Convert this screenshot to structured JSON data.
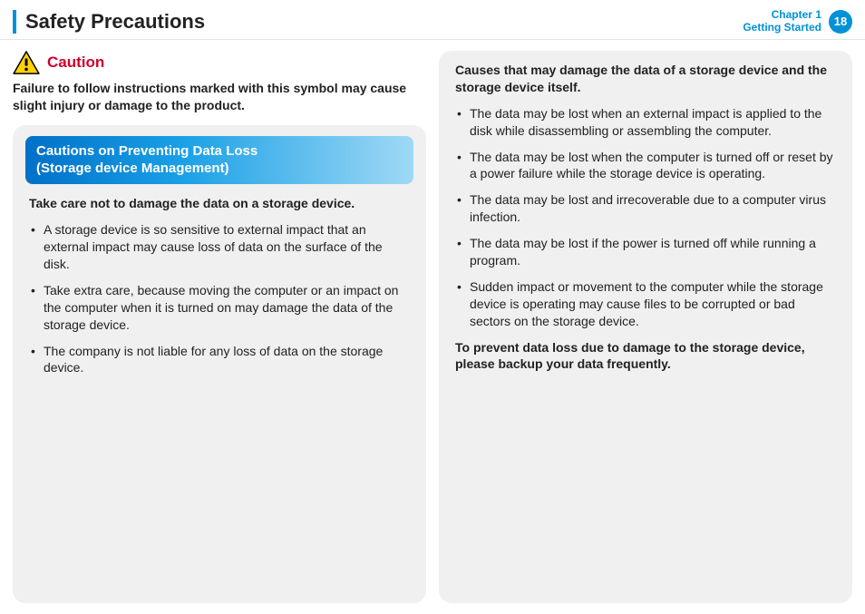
{
  "header": {
    "title": "Safety Precautions",
    "chapter_line1": "Chapter 1",
    "chapter_line2": "Getting Started",
    "page_number": "18"
  },
  "left": {
    "caution_label": "Caution",
    "caution_text": "Failure to follow instructions marked with this symbol may cause slight injury or damage to the product.",
    "subhead_line1": "Cautions on Preventing Data Loss",
    "subhead_line2": "(Storage device Management)",
    "strong": "Take care not to damage the data on a storage device.",
    "bullets": [
      "A storage device is so sensitive to external impact that an external impact may cause loss of data on the surface of the disk.",
      "Take extra care, because moving the computer or an impact on the computer when it is turned on may damage the data of the storage device.",
      "The company is not liable for any loss of data on the storage device."
    ]
  },
  "right": {
    "strong_top": "Causes that may damage the data of a storage device and the storage device itself.",
    "bullets": [
      "The data may be lost when an external impact is applied to the disk while disassembling or assembling the computer.",
      "The data may be lost when the computer is turned off or reset by a power failure while the storage device is operating.",
      "The data may be lost and irrecoverable due to a computer virus infection.",
      "The data may be lost if the power is turned off while running a program.",
      "Sudden impact or movement to the computer while the storage device is operating may cause files to be corrupted or bad sectors on the storage device."
    ],
    "strong_bottom": "To prevent data loss due to damage to the storage device, please backup your data frequently."
  }
}
